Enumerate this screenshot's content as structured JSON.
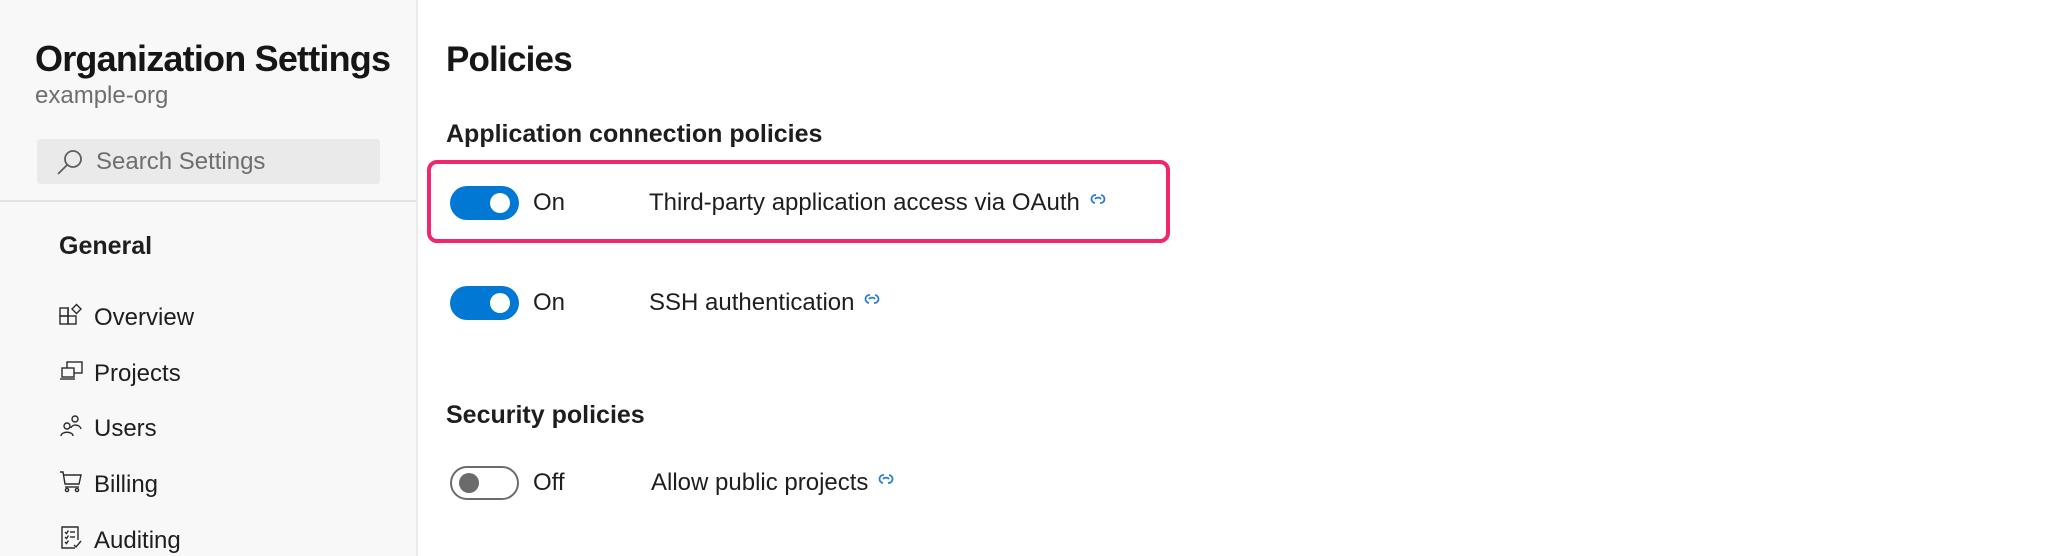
{
  "sidebar": {
    "title": "Organization Settings",
    "org_name": "example-org",
    "search": {
      "placeholder": "Search Settings",
      "value": "",
      "icon": "search-icon"
    },
    "section_label": "General",
    "items": [
      {
        "label": "Overview",
        "icon": "overview-icon"
      },
      {
        "label": "Projects",
        "icon": "projects-icon"
      },
      {
        "label": "Users",
        "icon": "users-icon"
      },
      {
        "label": "Billing",
        "icon": "cart-icon"
      },
      {
        "label": "Auditing",
        "icon": "checklist-icon"
      }
    ]
  },
  "main": {
    "title": "Policies",
    "groups": [
      {
        "title": "Application connection policies",
        "policies": [
          {
            "label": "Third-party application access via OAuth",
            "state": "On",
            "enabled": true,
            "highlighted": true,
            "icon": "link-icon"
          },
          {
            "label": "SSH authentication",
            "state": "On",
            "enabled": true,
            "highlighted": false,
            "icon": "link-icon"
          }
        ]
      },
      {
        "title": "Security policies",
        "policies": [
          {
            "label": "Allow public projects",
            "state": "Off",
            "enabled": false,
            "highlighted": false,
            "icon": "link-icon"
          }
        ]
      }
    ]
  },
  "colors": {
    "accent": "#0078d4",
    "highlight_border": "#f0266f",
    "toggle_off": "#6b6b6b",
    "sidebar_bg": "#f8f8f8",
    "link_icon": "#2b7cd3"
  }
}
